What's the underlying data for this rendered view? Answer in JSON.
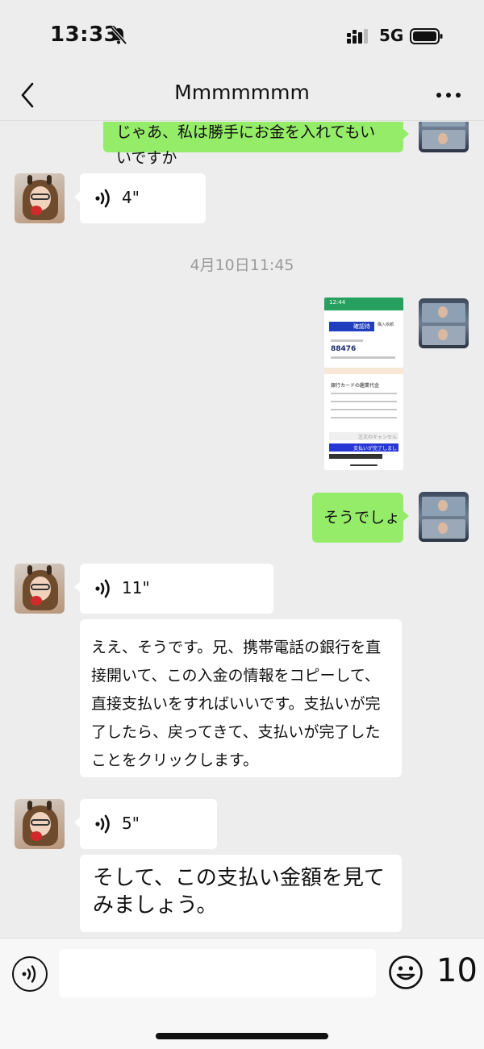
{
  "status_bar": {
    "time": "13:33",
    "network": "5G"
  },
  "nav": {
    "title": "Mmmmmmm"
  },
  "messages": {
    "partial_sent_text": "じゃあ、私は勝手にお金を入れてもいいですか",
    "voice_1": "4\"",
    "timestamp": "4月10日11:45",
    "screenshot": {
      "time": "12:44",
      "tag": "確認待ち",
      "tag_side": "購入依頼",
      "amount": "88476",
      "bank_heading": "銀行カードの趣業代金",
      "cancel_label": "注文のキャンセル",
      "confirm_label": "支払いが完了しました"
    },
    "sent_text": "そうでしょ",
    "voice_2": "11\"",
    "received_text": "ええ、そうです。兄、携帯電話の銀行を直接開いて、この入金の情報をコピーして、直接支払いをすればいいです。支払いが完了したら、戻ってきて、支払いが完了したことをクリックします。",
    "voice_3": "5\"",
    "received_text_large": "そして、この支払い金額を見てみましょう。"
  },
  "input_bar": {
    "placeholder": "",
    "number": "10"
  },
  "colors": {
    "sent_bubble": "#95ec69",
    "received_bubble": "#ffffff",
    "background": "#ededed"
  }
}
